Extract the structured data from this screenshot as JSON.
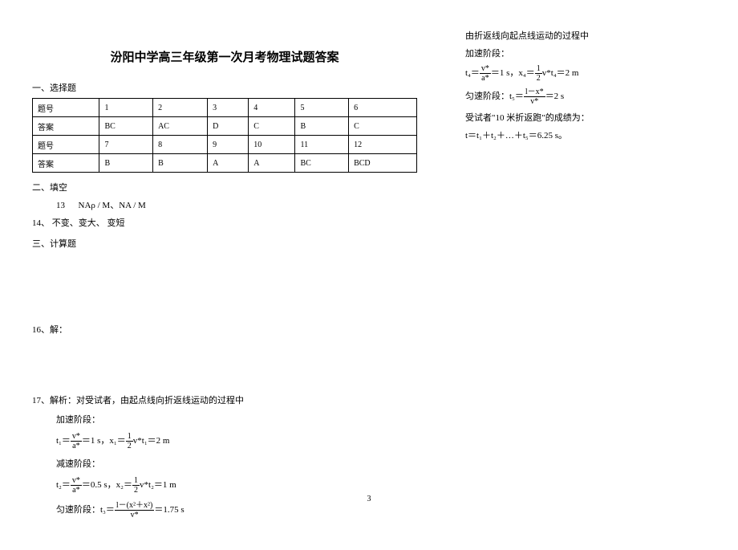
{
  "title": "汾阳中学高三年级第一次月考物理试题答案",
  "sections": {
    "s1": "一、选择题",
    "s2": "二、填空",
    "s3": "三、计算题"
  },
  "table": {
    "r1c0": "题号",
    "r1c1": "1",
    "r1c2": "2",
    "r1c3": "3",
    "r1c4": "4",
    "r1c5": "5",
    "r1c6": "6",
    "r2c0": "答案",
    "r2c1": "BC",
    "r2c2": "AC",
    "r2c3": "D",
    "r2c4": "C",
    "r2c5": "B",
    "r2c6": "C",
    "r3c0": "题号",
    "r3c1": "7",
    "r3c2": "8",
    "r3c3": "9",
    "r3c4": "10",
    "r3c5": "11",
    "r3c6": "12",
    "r4c0": "答案",
    "r4c1": "B",
    "r4c2": "B",
    "r4c3": "A",
    "r4c4": "A",
    "r4c5": "BC",
    "r4c6": "BCD"
  },
  "q13_label": "13",
  "q13_text": "NAρ / M、NA / M",
  "q14": "14、 不变、变大、 变短",
  "q16": "16、解：",
  "q17_intro": "17、解析：对受试者，由起点线向折返线运动的过程中",
  "accel_label": "加速阶段：",
  "decel_label": "减速阶段：",
  "const_label": "匀速阶段：",
  "t1_eq_prefix": "t₁＝",
  "t1_num": "v*",
  "t1_den": "a*",
  "t1_eq_mid": "＝1 s，x₁＝",
  "half_num": "1",
  "half_den": "2",
  "t1_eq_suffix": "v*t₁＝2 m",
  "t2_eq_prefix": "t₂＝",
  "t2_num": "v*",
  "t2_den": "a*",
  "t2_eq_mid": "＝0.5 s，x₂＝",
  "t2_eq_suffix": "v*t₂＝1 m",
  "t3_prefix": "匀速阶段：t₃＝",
  "t3_num": "l－(x²＋x²)",
  "t3_den": "v*",
  "t3_suffix": "＝1.75 s",
  "col2_line1": "由折返线向起点线运动的过程中",
  "col2_accel": "加速阶段：",
  "t4_prefix": "t₄＝",
  "t4_num": "v*",
  "t4_den": "a*",
  "t4_mid": "＝1 s，x₄＝",
  "t4_suffix": "v*t₄＝2 m",
  "t5_prefix": "匀速阶段：t₅＝",
  "t5_num": "l－x*",
  "t5_den": "v*",
  "t5_suffix": "＝2 s",
  "col2_result1": "受试者\"10 米折返跑\"的成绩为：",
  "col2_result2": "t＝t₁＋t₂＋…＋t₅＝6.25 s。",
  "page_num": "3"
}
